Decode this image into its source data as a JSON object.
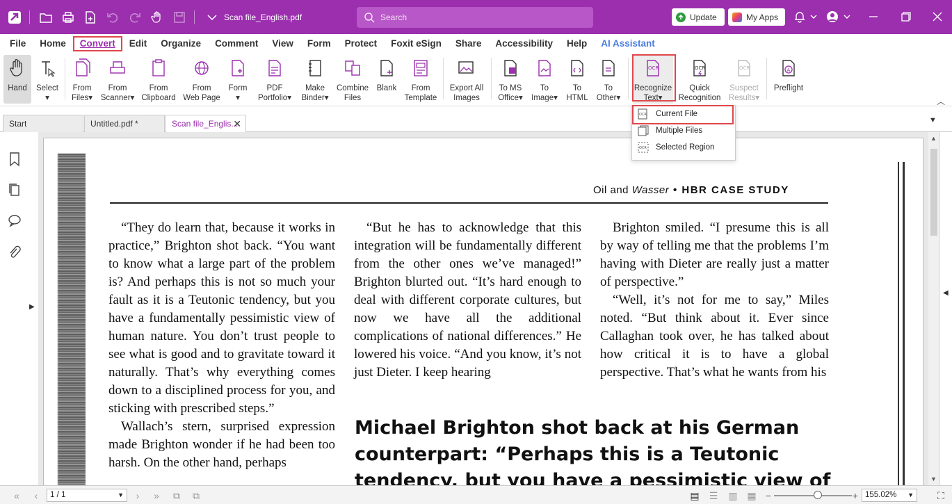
{
  "titlebar": {
    "doc_title": "Scan file_English.pdf",
    "search_placeholder": "Search",
    "update_label": "Update",
    "myapps_label": "My Apps",
    "accent_color": "#9b2fae"
  },
  "menu": {
    "items": [
      "File",
      "Home",
      "Convert",
      "Edit",
      "Organize",
      "Comment",
      "View",
      "Form",
      "Protect",
      "Foxit eSign",
      "Share",
      "Accessibility",
      "Help",
      "AI Assistant"
    ],
    "active": "Convert"
  },
  "ribbon": {
    "hand": "Hand",
    "select": "Select",
    "from_files": [
      "From",
      "Files"
    ],
    "from_scanner": [
      "From",
      "Scanner"
    ],
    "from_clipboard": [
      "From",
      "Clipboard"
    ],
    "from_webpage": [
      "From",
      "Web Page"
    ],
    "form": "Form",
    "pdf_portfolio": [
      "PDF",
      "Portfolio"
    ],
    "make_binder": [
      "Make",
      "Binder"
    ],
    "combine_files": [
      "Combine",
      "Files"
    ],
    "blank": "Blank",
    "from_template": [
      "From",
      "Template"
    ],
    "export_all_images": [
      "Export All",
      "Images"
    ],
    "to_ms_office": [
      "To MS",
      "Office"
    ],
    "to_image": [
      "To",
      "Image"
    ],
    "to_html": [
      "To",
      "HTML"
    ],
    "to_other": [
      "To",
      "Other"
    ],
    "recognize_text": [
      "Recognize",
      "Text"
    ],
    "quick_recognition": [
      "Quick",
      "Recognition"
    ],
    "suspect_results": [
      "Suspect",
      "Results"
    ],
    "preflight": "Preflight"
  },
  "dropdown": {
    "items": [
      "Current File",
      "Multiple Files",
      "Selected Region"
    ]
  },
  "tabs": [
    "Start",
    "Untitled.pdf *",
    "Scan file_Englis..."
  ],
  "document": {
    "header_plain": "Oil and ",
    "header_italic": "Wasser",
    "header_bold": " • HBR CASE STUDY",
    "col1": [
      "“They do learn that, because it works in practice,” Brighton shot back. “You want to know what a large part of the problem is? And perhaps this is not so much your fault as it is a Teutonic tendency, but you have a fundamentally pessimistic view of human nature. You don’t trust people to see what is good and to gravitate toward it naturally. That’s why everything comes down to a disciplined process for you, and sticking with prescribed steps.”",
      "Wallach’s stern, surprised expression made Brighton wonder if he had been too harsh. On the other hand, perhaps"
    ],
    "col2": [
      "“But he has to acknowledge that this integration will be fundamentally different from the other ones we’ve managed!” Brighton blurted out. “It’s hard enough to deal with different corporate cultures, but now we have all the additional complications of national differences.” He lowered his voice. “And you know, it’s not just Dieter. I keep hearing"
    ],
    "col3": [
      "Brighton smiled. “I presume this is all by way of telling me that the problems I’m having with Dieter are really just a matter of perspective.”",
      "“Well, it’s not for me to say,” Miles noted. “But think about it. Ever since Callaghan took over, he has talked about how critical it is to have a global perspective. That’s what he wants from his"
    ],
    "pullquote": "Michael Brighton shot back at his German counterpart: “Perhaps this is a Teutonic tendency, but you have a pessimistic view of human nature.”"
  },
  "status": {
    "page": "1 / 1",
    "zoom": "155.02%"
  }
}
